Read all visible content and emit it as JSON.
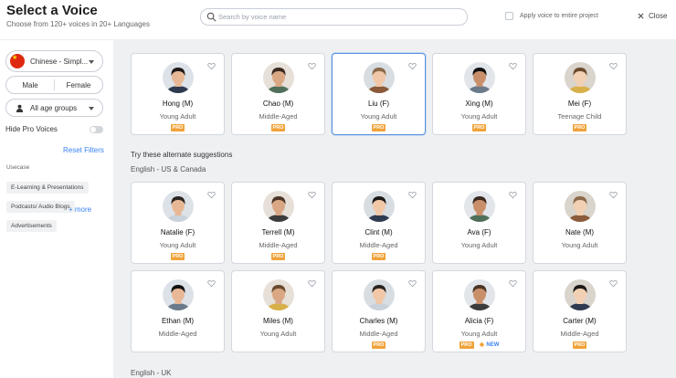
{
  "header": {
    "title": "Select a Voice",
    "subtitle": "Choose from 120+ voices in 20+ Languages",
    "search_placeholder": "Search by voice name",
    "apply_label": "Apply voice to entire project",
    "close_label": "Close"
  },
  "sidebar": {
    "language": "Chinese - Simpl...",
    "gender_male": "Male",
    "gender_female": "Female",
    "age_group": "All age groups",
    "hide_pro": "Hide Pro Voices",
    "reset": "Reset Filters",
    "usecase_title": "Usecase",
    "usecases": [
      "E-Learning & Presentations",
      "Podcasts/ Audio Blogs",
      "Advertisements"
    ],
    "more": "+ more"
  },
  "main": {
    "suggestions_label": "Try these alternate suggestions",
    "section_us": "English - US & Canada",
    "section_uk": "English - UK",
    "top_row": [
      {
        "name": "Hong (M)",
        "age": "Young Adult",
        "pro": "PRO"
      },
      {
        "name": "Chao (M)",
        "age": "Middle-Aged",
        "pro": "PRO"
      },
      {
        "name": "Liu (F)",
        "age": "Young Adult",
        "pro": "PRO"
      },
      {
        "name": "Xing (M)",
        "age": "Young Adult",
        "pro": "PRO"
      },
      {
        "name": "Mei (F)",
        "age": "Teenage Child",
        "pro": "PRO"
      }
    ],
    "us_row1": [
      {
        "name": "Natalie (F)",
        "age": "Young Adult",
        "pro": "PRO"
      },
      {
        "name": "Terrell (M)",
        "age": "Middle-Aged",
        "pro": "PRO"
      },
      {
        "name": "Clint (M)",
        "age": "Middle-Aged",
        "pro": "PRO"
      },
      {
        "name": "Ava (F)",
        "age": "Young Adult",
        "pro": ""
      },
      {
        "name": "Nate (M)",
        "age": "Young Adult",
        "pro": ""
      }
    ],
    "us_row2": [
      {
        "name": "Ethan (M)",
        "age": "Middle-Aged",
        "pro": ""
      },
      {
        "name": "Miles (M)",
        "age": "Young Adult",
        "pro": ""
      },
      {
        "name": "Charles (M)",
        "age": "Middle-Aged",
        "pro": "PRO"
      },
      {
        "name": "Alicia (F)",
        "age": "Young Adult",
        "pro": "PRO",
        "new": "NEW"
      },
      {
        "name": "Carter (M)",
        "age": "Middle-Aged",
        "pro": "PRO"
      }
    ]
  },
  "colors": {
    "accent": "#3b82f6",
    "pro_badge": "#f0a33a",
    "selected_border": "#5b8fdc",
    "main_bg": "#eef0f2"
  }
}
